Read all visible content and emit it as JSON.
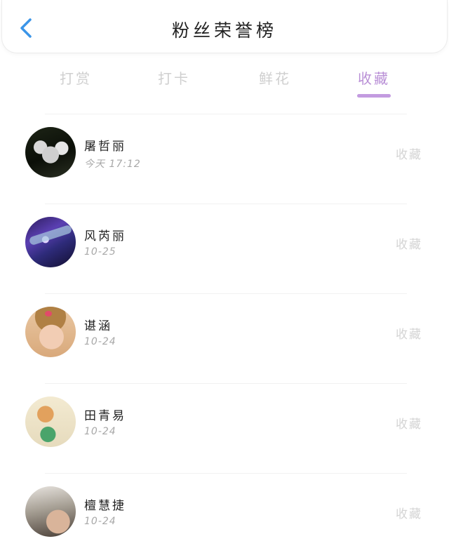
{
  "header": {
    "title": "粉丝荣誉榜",
    "back_icon": "chevron-left-icon",
    "accent_color": "#3b95e8"
  },
  "tabs": [
    {
      "label": "打赏",
      "active": false
    },
    {
      "label": "打卡",
      "active": false
    },
    {
      "label": "鲜花",
      "active": false
    },
    {
      "label": "收藏",
      "active": true
    }
  ],
  "tab_active_color": "#b98fd6",
  "fans": [
    {
      "name": "屠哲丽",
      "time": "今天 17:12",
      "action": "收藏"
    },
    {
      "name": "风芮丽",
      "time": "10-25",
      "action": "收藏"
    },
    {
      "name": "谌涵",
      "time": "10-24",
      "action": "收藏"
    },
    {
      "name": "田青易",
      "time": "10-24",
      "action": "收藏"
    },
    {
      "name": "檀慧捷",
      "time": "10-24",
      "action": "收藏"
    }
  ]
}
